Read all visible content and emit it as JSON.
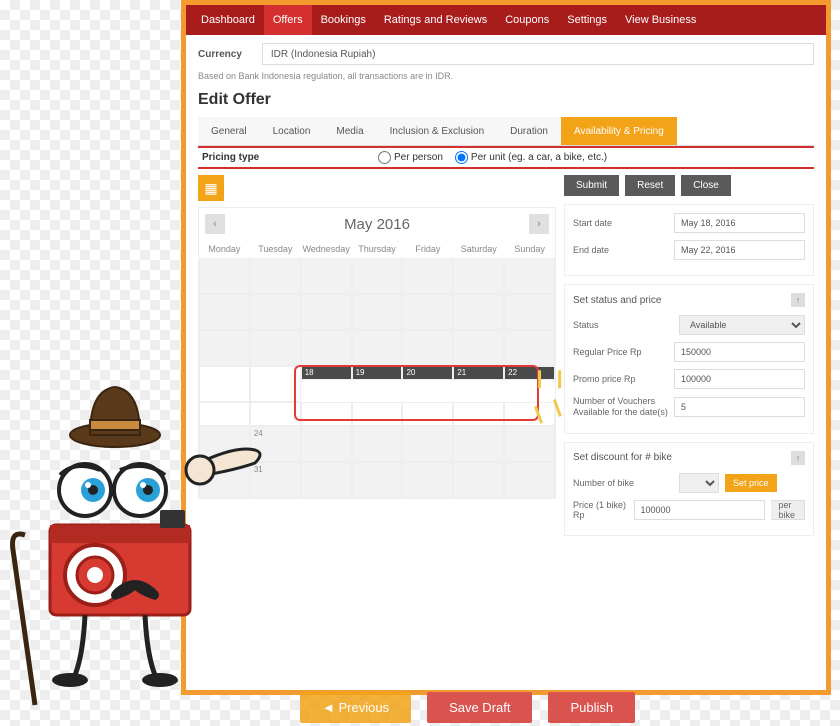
{
  "nav": {
    "items": [
      "Dashboard",
      "Offers",
      "Bookings",
      "Ratings and Reviews",
      "Coupons",
      "Settings",
      "View Business"
    ],
    "active": 1
  },
  "currency": {
    "label": "Currency",
    "value": "IDR (Indonesia Rupiah)",
    "note": "Based on Bank Indonesia regulation, all transactions are in IDR."
  },
  "page_title": "Edit Offer",
  "tabs": {
    "items": [
      "General",
      "Location",
      "Media",
      "Inclusion & Exclusion",
      "Duration",
      "Availability & Pricing"
    ],
    "active": 5
  },
  "pricing_type": {
    "label": "Pricing type",
    "per_person": "Per person",
    "per_unit": "Per unit (eg. a car, a bike, etc.)",
    "selected": "per_unit"
  },
  "calendar": {
    "title": "May 2016",
    "dow": [
      "Monday",
      "Tuesday",
      "Wednesday",
      "Thursday",
      "Friday",
      "Saturday",
      "Sunday"
    ],
    "weeks": [
      [
        "",
        "",
        "",
        "",
        "",
        "",
        ""
      ],
      [
        "",
        "",
        "",
        "",
        "",
        "",
        ""
      ],
      [
        "",
        "",
        "",
        "",
        "",
        "",
        ""
      ],
      [
        "",
        "",
        "18",
        "19",
        "20",
        "21",
        "22"
      ],
      [
        "",
        "24",
        "",
        "",
        "",
        "",
        ""
      ],
      [
        "",
        "31",
        "",
        "",
        "",
        "",
        ""
      ]
    ],
    "highlighted_week_index": 3
  },
  "buttons": {
    "submit": "Submit",
    "reset": "Reset",
    "close": "Close"
  },
  "dates": {
    "start_label": "Start date",
    "start_value": "May 18, 2016",
    "end_label": "End date",
    "end_value": "May 22, 2016"
  },
  "status_panel": {
    "title": "Set status and price",
    "status_label": "Status",
    "status_value": "Available",
    "regular_label": "Regular Price Rp",
    "regular_value": "150000",
    "promo_label": "Promo price Rp",
    "promo_value": "100000",
    "vouchers_label": "Number of Vouchers Available for the date(s)",
    "vouchers_value": "5"
  },
  "discount_panel": {
    "title": "Set discount for # bike",
    "number_label": "Number of bike",
    "set_price": "Set price",
    "price_label": "Price (1 bike) Rp",
    "price_value": "100000",
    "suffix": "per bike"
  },
  "footer": {
    "previous": "Previous",
    "save_draft": "Save Draft",
    "publish": "Publish"
  }
}
